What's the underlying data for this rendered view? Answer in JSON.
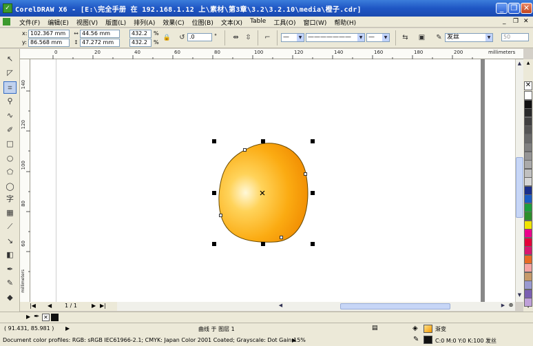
{
  "titlebar": {
    "title": "CorelDRAW X6 - [E:\\完全手册 在 192.168.1.12 上\\素材\\第3章\\3.2\\3.2.10\\media\\橙子.cdr]",
    "minimize": "_",
    "restore": "❐",
    "close": "✕"
  },
  "menubar": {
    "items": [
      "文件(F)",
      "编辑(E)",
      "视图(V)",
      "版面(L)",
      "排列(A)",
      "效果(C)",
      "位图(B)",
      "文本(X)",
      "Table",
      "工具(O)",
      "窗口(W)",
      "帮助(H)"
    ],
    "doc_minimize": "_",
    "doc_restore": "❐",
    "doc_close": "✕"
  },
  "propbar": {
    "x_label": "x:",
    "x_value": "102.367 mm",
    "y_label": "y:",
    "y_value": "86.568 mm",
    "w_value": "44.56 mm",
    "h_value": "47.272 mm",
    "scale_x": "432.2",
    "scale_y": "432.2",
    "pct": "%",
    "rotation": ".0",
    "degree": "°",
    "outline_width": "发丝",
    "num_box": "50"
  },
  "rulers": {
    "units": "millimeters",
    "h_ticks": [
      "0",
      "20",
      "40",
      "60",
      "80",
      "100",
      "120",
      "140",
      "160",
      "180",
      "200"
    ],
    "v_ticks": [
      "140",
      "120",
      "100",
      "80",
      "60"
    ]
  },
  "pagenav": {
    "page_count": "1 / 1",
    "page_tab": "页 1"
  },
  "status": {
    "coords": "( 91.431, 85.981 )",
    "object_info": "曲线 于 图层 1",
    "color_profiles": "Document color profiles: RGB: sRGB IEC61966-2.1; CMYK: Japan Color 2001 Coated; Grayscale: Dot Gain 15%",
    "fill_label": "渐变",
    "outline_label": "C:0 M:0 Y:0 K:100  发丝"
  },
  "palette": {
    "colors": [
      "#ffffff",
      "#111111",
      "#2a2a2a",
      "#404040",
      "#555555",
      "#6a6a6a",
      "#808080",
      "#959595",
      "#aaaaaa",
      "#c0c0c0",
      "#d5d5d5",
      "#1a2f8c",
      "#1a5cc4",
      "#1c9e3c",
      "#2b8f2b",
      "#f1e500",
      "#ec008c",
      "#e4003a",
      "#d8166f",
      "#e86a24",
      "#f4a3a3",
      "#c79a6a",
      "#9a9ad0",
      "#7b5fb1",
      "#bfa0d8"
    ]
  },
  "fill_color": "#f59a00",
  "accent_color": "#316ac5"
}
